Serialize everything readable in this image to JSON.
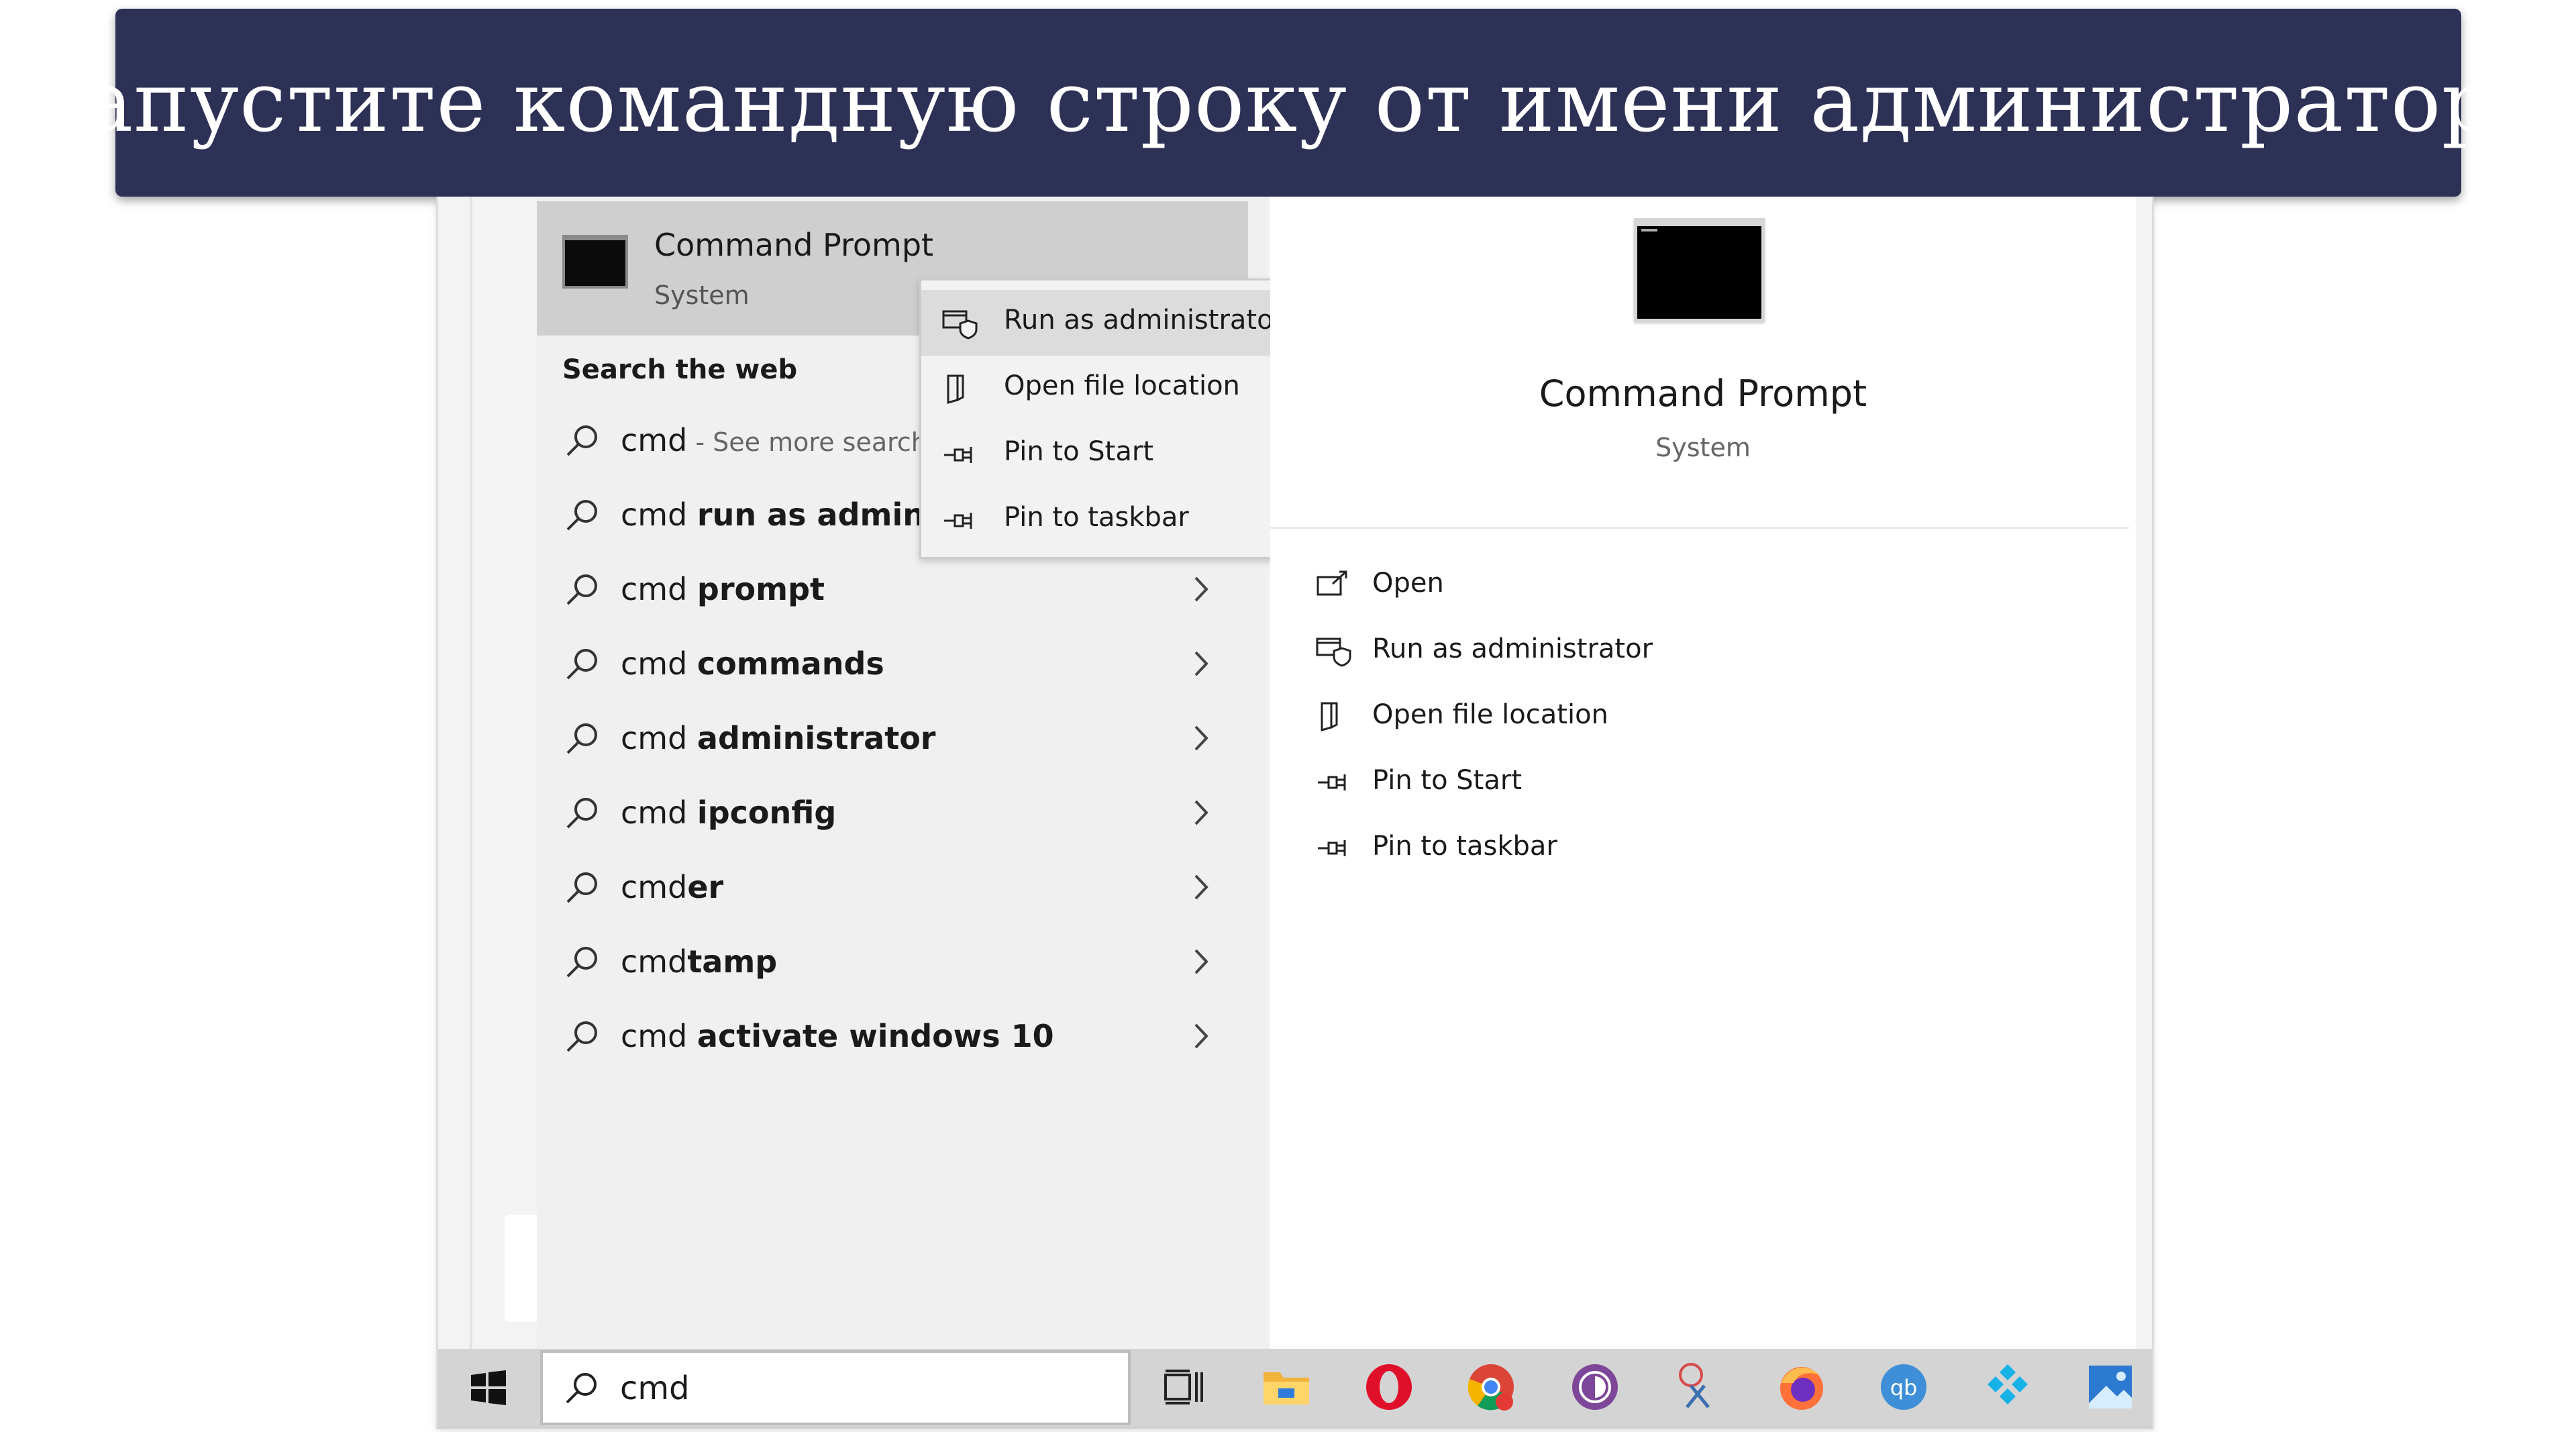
{
  "banner": {
    "title": "Запустите командную строку от имени администратора"
  },
  "best_match": {
    "title": "Command Prompt",
    "subtitle": "System"
  },
  "search_web": {
    "heading": "Search the web",
    "results": [
      {
        "query": "cmd",
        "bold": "",
        "suffix": " - See more search r",
        "chevron": false
      },
      {
        "query": "cmd ",
        "bold": "run as administra",
        "suffix": "",
        "chevron": false
      },
      {
        "query": "cmd ",
        "bold": "prompt",
        "suffix": "",
        "chevron": true
      },
      {
        "query": "cmd ",
        "bold": "commands",
        "suffix": "",
        "chevron": true
      },
      {
        "query": "cmd ",
        "bold": "administrator",
        "suffix": "",
        "chevron": true
      },
      {
        "query": "cmd ",
        "bold": "ipconfig",
        "suffix": "",
        "chevron": true
      },
      {
        "query": "cmd",
        "bold": "er",
        "suffix": "",
        "chevron": true
      },
      {
        "query": "cmd",
        "bold": "tamp",
        "suffix": "",
        "chevron": true
      },
      {
        "query": "cmd ",
        "bold": "activate windows 10",
        "suffix": "",
        "chevron": true
      }
    ]
  },
  "context_menu": {
    "items": [
      {
        "label": "Run as administrator",
        "icon": "shield-window-icon",
        "highlighted": true
      },
      {
        "label": "Open file location",
        "icon": "folder-location-icon",
        "highlighted": false
      },
      {
        "label": "Pin to Start",
        "icon": "pin-icon",
        "highlighted": false
      },
      {
        "label": "Pin to taskbar",
        "icon": "pin-icon",
        "highlighted": false
      }
    ]
  },
  "detail": {
    "title": "Command Prompt",
    "subtitle": "System",
    "actions": [
      {
        "label": "Open",
        "icon": "open-icon"
      },
      {
        "label": "Run as administrator",
        "icon": "shield-window-icon"
      },
      {
        "label": "Open file location",
        "icon": "folder-location-icon"
      },
      {
        "label": "Pin to Start",
        "icon": "pin-icon"
      },
      {
        "label": "Pin to taskbar",
        "icon": "pin-icon"
      }
    ]
  },
  "taskbar": {
    "search_value": "cmd",
    "icons": [
      "task-view-icon",
      "file-explorer-icon",
      "opera-icon",
      "chrome-icon",
      "tor-browser-icon",
      "snipping-tool-icon",
      "firefox-icon",
      "qbittorrent-icon",
      "kodi-icon",
      "photos-icon"
    ],
    "qbittorrent_text": "qb"
  },
  "colors": {
    "banner": "#2e3156",
    "highlight": "#cfcfcf",
    "taskbar": "#d4d4d4"
  }
}
